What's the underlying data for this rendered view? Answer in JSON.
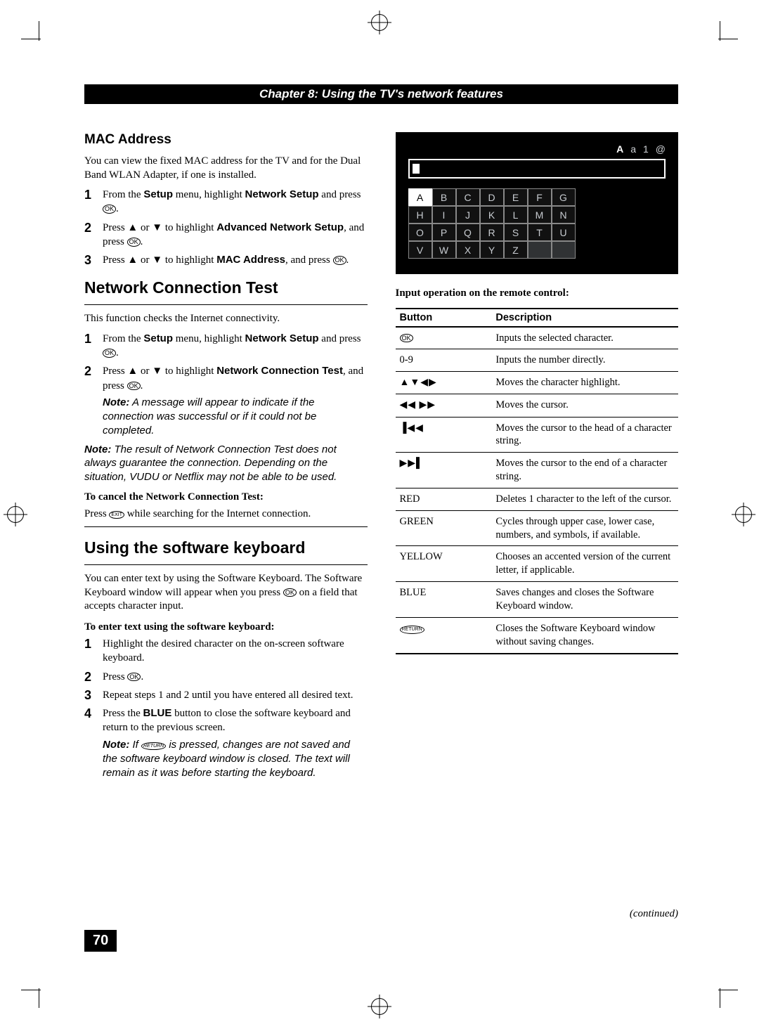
{
  "header": "Chapter 8: Using the TV's network features",
  "left": {
    "mac": {
      "heading": "MAC Address",
      "intro": "You can view the fixed MAC address for the TV and for the Dual Band WLAN Adapter, if one is installed.",
      "step1_a": "From the ",
      "step1_b": "Setup",
      "step1_c": " menu, highlight ",
      "step1_d": "Network Setup",
      "step1_e": " and press ",
      "step2_a": "Press ▲ or ▼ to highlight ",
      "step2_b": "Advanced Network Setup",
      "step2_c": ", and press ",
      "step3_a": "Press ▲ or ▼ to highlight ",
      "step3_b": "MAC Address",
      "step3_c": ", and press "
    },
    "nct": {
      "heading": "Network Connection Test",
      "intro": "This function checks the Internet connectivity.",
      "step1_a": "From the ",
      "step1_b": "Setup",
      "step1_c": " menu, highlight ",
      "step1_d": "Network Setup",
      "step1_e": " and press ",
      "step2_a": "Press ▲ or ▼ to highlight ",
      "step2_b": "Network Connection Test",
      "step2_c": ", and press ",
      "note_label": "Note:",
      "note_text": " A message will appear to indicate if the connection was successful or if it could not be completed.",
      "note2_label": "Note:",
      "note2_text": " The result of Network Connection Test does not always guarantee the connection. Depending on the situation, VUDU or Netflix may not be able to be used.",
      "cancel_head": "To cancel the Network Connection Test:",
      "cancel_a": "Press ",
      "cancel_b": " while searching for the Internet connection."
    },
    "sk": {
      "heading": "Using the software keyboard",
      "intro_a": "You can enter text by using the Software Keyboard. The Software Keyboard window will appear when you press ",
      "intro_b": " on a field that accepts character input.",
      "subhead": "To enter text using the software keyboard:",
      "step1": "Highlight the desired character on the on-screen software keyboard.",
      "step2": "Press ",
      "step3": "Repeat steps 1 and 2 until you have entered all desired text.",
      "step4_a": "Press the ",
      "step4_b": "BLUE",
      "step4_c": " button to close the software keyboard and return to the previous screen.",
      "note_label": "Note:",
      "note_a": " If ",
      "note_b": " is pressed, changes are not saved and the software keyboard window is closed. The text will remain as it was before starting the keyboard."
    }
  },
  "osk": {
    "modes": [
      "A",
      "a",
      "1",
      "@"
    ],
    "grid": [
      "A",
      "B",
      "C",
      "D",
      "E",
      "F",
      "G",
      "H",
      "I",
      "J",
      "K",
      "L",
      "M",
      "N",
      "O",
      "P",
      "Q",
      "R",
      "S",
      "T",
      "U",
      "V",
      "W",
      "X",
      "Y",
      "Z"
    ]
  },
  "table": {
    "title": "Input operation on the remote control:",
    "head_button": "Button",
    "head_desc": "Description",
    "rows": [
      {
        "btn": "OK",
        "btn_type": "ok",
        "desc": "Inputs the selected character."
      },
      {
        "btn": "0-9",
        "btn_type": "text",
        "desc": "Inputs the number directly."
      },
      {
        "btn": "▲▼◀▶",
        "btn_type": "arrows",
        "desc": "Moves the character highlight."
      },
      {
        "btn": "◀◀  ▶▶",
        "btn_type": "arrows",
        "desc": "Moves the cursor."
      },
      {
        "btn": "▐◀◀",
        "btn_type": "arrows",
        "desc": "Moves the cursor to the head of a character string."
      },
      {
        "btn": "▶▶▌",
        "btn_type": "arrows",
        "desc": "Moves the cursor to the end of a character string."
      },
      {
        "btn": "RED",
        "btn_type": "text",
        "desc": "Deletes 1 character to the left of the cursor."
      },
      {
        "btn": "GREEN",
        "btn_type": "text",
        "desc": "Cycles through upper case, lower case, numbers, and symbols, if available."
      },
      {
        "btn": "YELLOW",
        "btn_type": "text",
        "desc": "Chooses an accented version of the current letter, if applicable."
      },
      {
        "btn": "BLUE",
        "btn_type": "text",
        "desc": "Saves changes and closes the Software Keyboard window."
      },
      {
        "btn": "RETURN",
        "btn_type": "return",
        "desc": "Closes the Software Keyboard window without saving changes."
      }
    ]
  },
  "continued": "(continued)",
  "page_number": "70",
  "icons": {
    "ok": "OK",
    "exit": "EXIT",
    "return": "RETURN"
  }
}
